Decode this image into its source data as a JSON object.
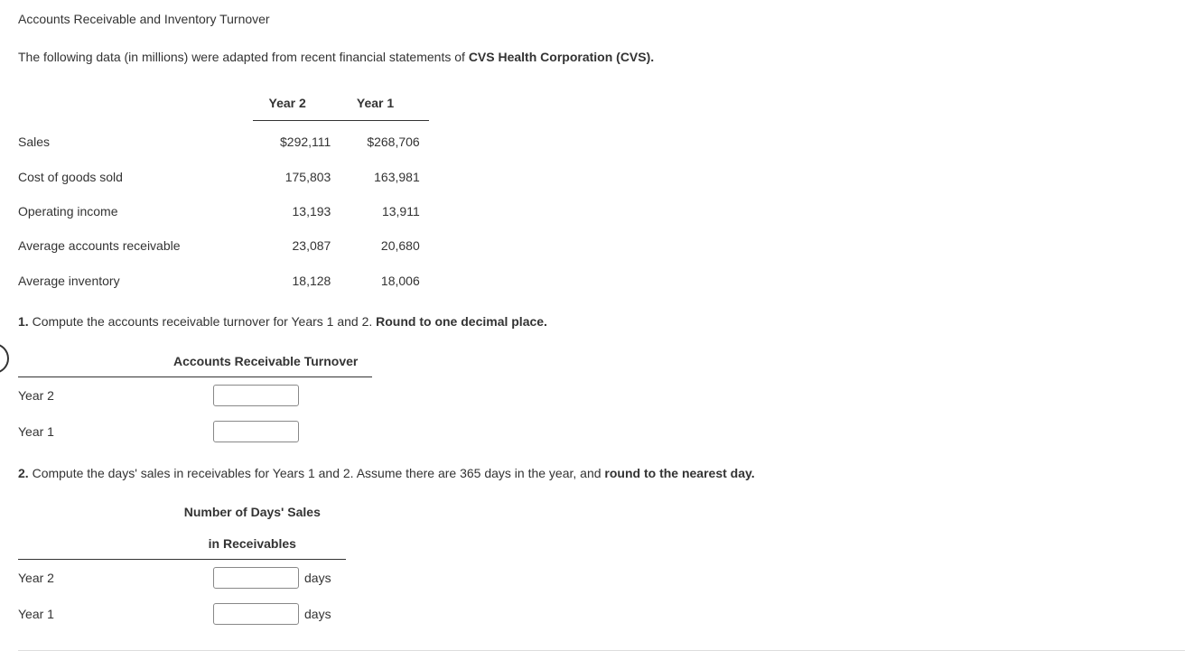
{
  "title": "Accounts Receivable and Inventory Turnover",
  "intro_prefix": "The following data (in millions) were adapted from recent financial statements of ",
  "intro_bold": "CVS Health Corporation (CVS).",
  "data_table": {
    "col1": "Year 2",
    "col2": "Year 1",
    "rows": [
      {
        "label": "Sales",
        "y2": "$292,111",
        "y1": "$268,706"
      },
      {
        "label": "Cost of goods sold",
        "y2": "175,803",
        "y1": "163,981"
      },
      {
        "label": "Operating income",
        "y2": "13,193",
        "y1": "13,911"
      },
      {
        "label": "Average accounts receivable",
        "y2": "23,087",
        "y1": "20,680"
      },
      {
        "label": "Average inventory",
        "y2": "18,128",
        "y1": "18,006"
      }
    ]
  },
  "q1": {
    "num": "1.",
    "text": " Compute the accounts receivable turnover for Years 1 and 2. ",
    "bold": "Round to one decimal place.",
    "header": "Accounts Receivable Turnover",
    "row1": "Year 2",
    "row2": "Year 1"
  },
  "q2": {
    "num": "2.",
    "text": " Compute the days' sales in receivables for Years 1 and 2. Assume there are 365 days in the year, and ",
    "bold": "round to the nearest day.",
    "header1": "Number of Days' Sales",
    "header2": "in Receivables",
    "row1": "Year 2",
    "row2": "Year 1",
    "unit": "days"
  }
}
